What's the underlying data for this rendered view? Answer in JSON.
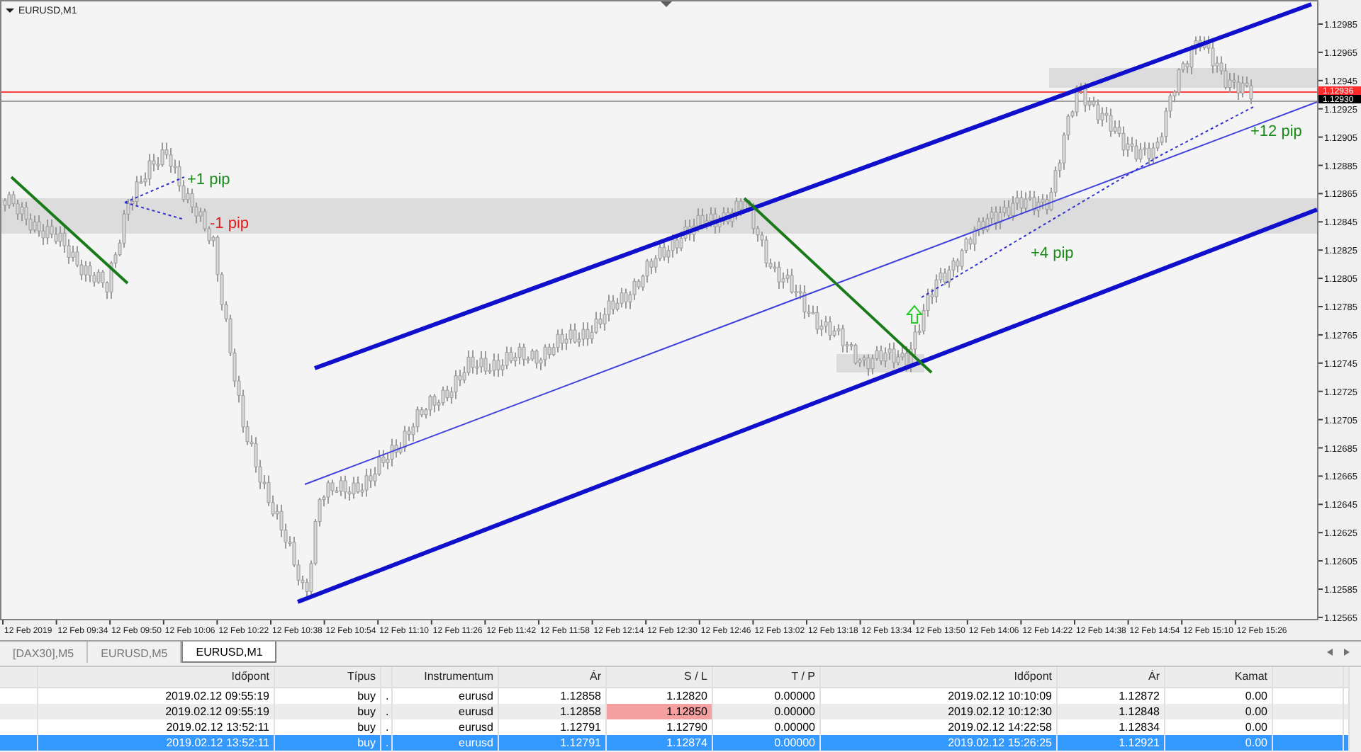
{
  "chart": {
    "title": "EURUSD,M1",
    "price_labels": [
      "1.12985",
      "1.12965",
      "1.12945",
      "1.12925",
      "1.12905",
      "1.12885",
      "1.12865",
      "1.12845",
      "1.12825",
      "1.12805",
      "1.12785",
      "1.12765",
      "1.12745",
      "1.12725",
      "1.12705",
      "1.12685",
      "1.12665",
      "1.12645",
      "1.12625",
      "1.12605",
      "1.12585",
      "1.12565"
    ],
    "price_tags": [
      {
        "text": "1.12936",
        "kind": "bid"
      },
      {
        "text": "1.12930",
        "kind": "ask"
      }
    ],
    "time_labels": [
      "12 Feb 2019",
      "12 Feb 09:34",
      "12 Feb 09:50",
      "12 Feb 10:06",
      "12 Feb 10:22",
      "12 Feb 10:38",
      "12 Feb 10:54",
      "12 Feb 11:10",
      "12 Feb 11:26",
      "12 Feb 11:42",
      "12 Feb 11:58",
      "12 Feb 12:14",
      "12 Feb 12:30",
      "12 Feb 12:46",
      "12 Feb 13:02",
      "12 Feb 13:18",
      "12 Feb 13:34",
      "12 Feb 13:50",
      "12 Feb 14:06",
      "12 Feb 14:22",
      "12 Feb 14:38",
      "12 Feb 14:54",
      "12 Feb 15:10",
      "12 Feb 15:26"
    ],
    "annotations": [
      {
        "text": "+1 pip",
        "color": "#1a8a1a"
      },
      {
        "text": "-1 pip",
        "color": "#e02020"
      },
      {
        "text": "+4 pip",
        "color": "#1a8a1a"
      },
      {
        "text": "+12 pip",
        "color": "#1a8a1a"
      }
    ]
  },
  "tabs": [
    {
      "label": "[DAX30],M5",
      "selected": false
    },
    {
      "label": "EURUSD,M5",
      "selected": false
    },
    {
      "label": "EURUSD,M1",
      "selected": true
    }
  ],
  "table": {
    "columns": [
      "",
      "Időpont",
      "Típus",
      "",
      "Instrumentum",
      "Ár",
      "S / L",
      "T / P",
      "Időpont",
      "Ár",
      "Kamat",
      ""
    ],
    "rows": [
      {
        "selected": false,
        "sl_alert": false,
        "cells": [
          "",
          "2019.02.12 09:55:19",
          "buy",
          ".",
          "eurusd",
          "1.12858",
          "1.12820",
          "0.00000",
          "2019.02.12 10:10:09",
          "1.12872",
          "0.00",
          ""
        ]
      },
      {
        "selected": false,
        "sl_alert": true,
        "cells": [
          "",
          "2019.02.12 09:55:19",
          "buy",
          ".",
          "eurusd",
          "1.12858",
          "1.12850",
          "0.00000",
          "2019.02.12 10:12:30",
          "1.12848",
          "0.00",
          ""
        ]
      },
      {
        "selected": false,
        "sl_alert": false,
        "cells": [
          "",
          "2019.02.12 13:52:11",
          "buy",
          ".",
          "eurusd",
          "1.12791",
          "1.12790",
          "0.00000",
          "2019.02.12 14:22:58",
          "1.12834",
          "0.00",
          ""
        ]
      },
      {
        "selected": true,
        "sl_alert": false,
        "cells": [
          "",
          "2019.02.12 13:52:11",
          "buy",
          ".",
          "eurusd",
          "1.12791",
          "1.12874",
          "0.00000",
          "2019.02.12 15:26:25",
          "1.12921",
          "0.00",
          ""
        ]
      }
    ]
  }
}
